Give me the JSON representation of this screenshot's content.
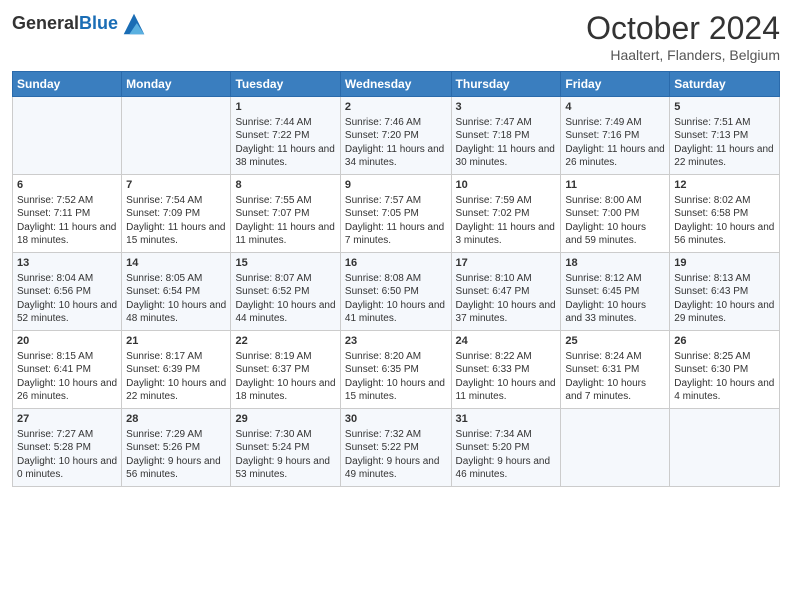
{
  "header": {
    "logo_general": "General",
    "logo_blue": "Blue",
    "month_title": "October 2024",
    "subtitle": "Haaltert, Flanders, Belgium"
  },
  "days_of_week": [
    "Sunday",
    "Monday",
    "Tuesday",
    "Wednesday",
    "Thursday",
    "Friday",
    "Saturday"
  ],
  "weeks": [
    [
      {
        "day": "",
        "sunrise": "",
        "sunset": "",
        "daylight": ""
      },
      {
        "day": "",
        "sunrise": "",
        "sunset": "",
        "daylight": ""
      },
      {
        "day": "1",
        "sunrise": "Sunrise: 7:44 AM",
        "sunset": "Sunset: 7:22 PM",
        "daylight": "Daylight: 11 hours and 38 minutes."
      },
      {
        "day": "2",
        "sunrise": "Sunrise: 7:46 AM",
        "sunset": "Sunset: 7:20 PM",
        "daylight": "Daylight: 11 hours and 34 minutes."
      },
      {
        "day": "3",
        "sunrise": "Sunrise: 7:47 AM",
        "sunset": "Sunset: 7:18 PM",
        "daylight": "Daylight: 11 hours and 30 minutes."
      },
      {
        "day": "4",
        "sunrise": "Sunrise: 7:49 AM",
        "sunset": "Sunset: 7:16 PM",
        "daylight": "Daylight: 11 hours and 26 minutes."
      },
      {
        "day": "5",
        "sunrise": "Sunrise: 7:51 AM",
        "sunset": "Sunset: 7:13 PM",
        "daylight": "Daylight: 11 hours and 22 minutes."
      }
    ],
    [
      {
        "day": "6",
        "sunrise": "Sunrise: 7:52 AM",
        "sunset": "Sunset: 7:11 PM",
        "daylight": "Daylight: 11 hours and 18 minutes."
      },
      {
        "day": "7",
        "sunrise": "Sunrise: 7:54 AM",
        "sunset": "Sunset: 7:09 PM",
        "daylight": "Daylight: 11 hours and 15 minutes."
      },
      {
        "day": "8",
        "sunrise": "Sunrise: 7:55 AM",
        "sunset": "Sunset: 7:07 PM",
        "daylight": "Daylight: 11 hours and 11 minutes."
      },
      {
        "day": "9",
        "sunrise": "Sunrise: 7:57 AM",
        "sunset": "Sunset: 7:05 PM",
        "daylight": "Daylight: 11 hours and 7 minutes."
      },
      {
        "day": "10",
        "sunrise": "Sunrise: 7:59 AM",
        "sunset": "Sunset: 7:02 PM",
        "daylight": "Daylight: 11 hours and 3 minutes."
      },
      {
        "day": "11",
        "sunrise": "Sunrise: 8:00 AM",
        "sunset": "Sunset: 7:00 PM",
        "daylight": "Daylight: 10 hours and 59 minutes."
      },
      {
        "day": "12",
        "sunrise": "Sunrise: 8:02 AM",
        "sunset": "Sunset: 6:58 PM",
        "daylight": "Daylight: 10 hours and 56 minutes."
      }
    ],
    [
      {
        "day": "13",
        "sunrise": "Sunrise: 8:04 AM",
        "sunset": "Sunset: 6:56 PM",
        "daylight": "Daylight: 10 hours and 52 minutes."
      },
      {
        "day": "14",
        "sunrise": "Sunrise: 8:05 AM",
        "sunset": "Sunset: 6:54 PM",
        "daylight": "Daylight: 10 hours and 48 minutes."
      },
      {
        "day": "15",
        "sunrise": "Sunrise: 8:07 AM",
        "sunset": "Sunset: 6:52 PM",
        "daylight": "Daylight: 10 hours and 44 minutes."
      },
      {
        "day": "16",
        "sunrise": "Sunrise: 8:08 AM",
        "sunset": "Sunset: 6:50 PM",
        "daylight": "Daylight: 10 hours and 41 minutes."
      },
      {
        "day": "17",
        "sunrise": "Sunrise: 8:10 AM",
        "sunset": "Sunset: 6:47 PM",
        "daylight": "Daylight: 10 hours and 37 minutes."
      },
      {
        "day": "18",
        "sunrise": "Sunrise: 8:12 AM",
        "sunset": "Sunset: 6:45 PM",
        "daylight": "Daylight: 10 hours and 33 minutes."
      },
      {
        "day": "19",
        "sunrise": "Sunrise: 8:13 AM",
        "sunset": "Sunset: 6:43 PM",
        "daylight": "Daylight: 10 hours and 29 minutes."
      }
    ],
    [
      {
        "day": "20",
        "sunrise": "Sunrise: 8:15 AM",
        "sunset": "Sunset: 6:41 PM",
        "daylight": "Daylight: 10 hours and 26 minutes."
      },
      {
        "day": "21",
        "sunrise": "Sunrise: 8:17 AM",
        "sunset": "Sunset: 6:39 PM",
        "daylight": "Daylight: 10 hours and 22 minutes."
      },
      {
        "day": "22",
        "sunrise": "Sunrise: 8:19 AM",
        "sunset": "Sunset: 6:37 PM",
        "daylight": "Daylight: 10 hours and 18 minutes."
      },
      {
        "day": "23",
        "sunrise": "Sunrise: 8:20 AM",
        "sunset": "Sunset: 6:35 PM",
        "daylight": "Daylight: 10 hours and 15 minutes."
      },
      {
        "day": "24",
        "sunrise": "Sunrise: 8:22 AM",
        "sunset": "Sunset: 6:33 PM",
        "daylight": "Daylight: 10 hours and 11 minutes."
      },
      {
        "day": "25",
        "sunrise": "Sunrise: 8:24 AM",
        "sunset": "Sunset: 6:31 PM",
        "daylight": "Daylight: 10 hours and 7 minutes."
      },
      {
        "day": "26",
        "sunrise": "Sunrise: 8:25 AM",
        "sunset": "Sunset: 6:30 PM",
        "daylight": "Daylight: 10 hours and 4 minutes."
      }
    ],
    [
      {
        "day": "27",
        "sunrise": "Sunrise: 7:27 AM",
        "sunset": "Sunset: 5:28 PM",
        "daylight": "Daylight: 10 hours and 0 minutes."
      },
      {
        "day": "28",
        "sunrise": "Sunrise: 7:29 AM",
        "sunset": "Sunset: 5:26 PM",
        "daylight": "Daylight: 9 hours and 56 minutes."
      },
      {
        "day": "29",
        "sunrise": "Sunrise: 7:30 AM",
        "sunset": "Sunset: 5:24 PM",
        "daylight": "Daylight: 9 hours and 53 minutes."
      },
      {
        "day": "30",
        "sunrise": "Sunrise: 7:32 AM",
        "sunset": "Sunset: 5:22 PM",
        "daylight": "Daylight: 9 hours and 49 minutes."
      },
      {
        "day": "31",
        "sunrise": "Sunrise: 7:34 AM",
        "sunset": "Sunset: 5:20 PM",
        "daylight": "Daylight: 9 hours and 46 minutes."
      },
      {
        "day": "",
        "sunrise": "",
        "sunset": "",
        "daylight": ""
      },
      {
        "day": "",
        "sunrise": "",
        "sunset": "",
        "daylight": ""
      }
    ]
  ]
}
